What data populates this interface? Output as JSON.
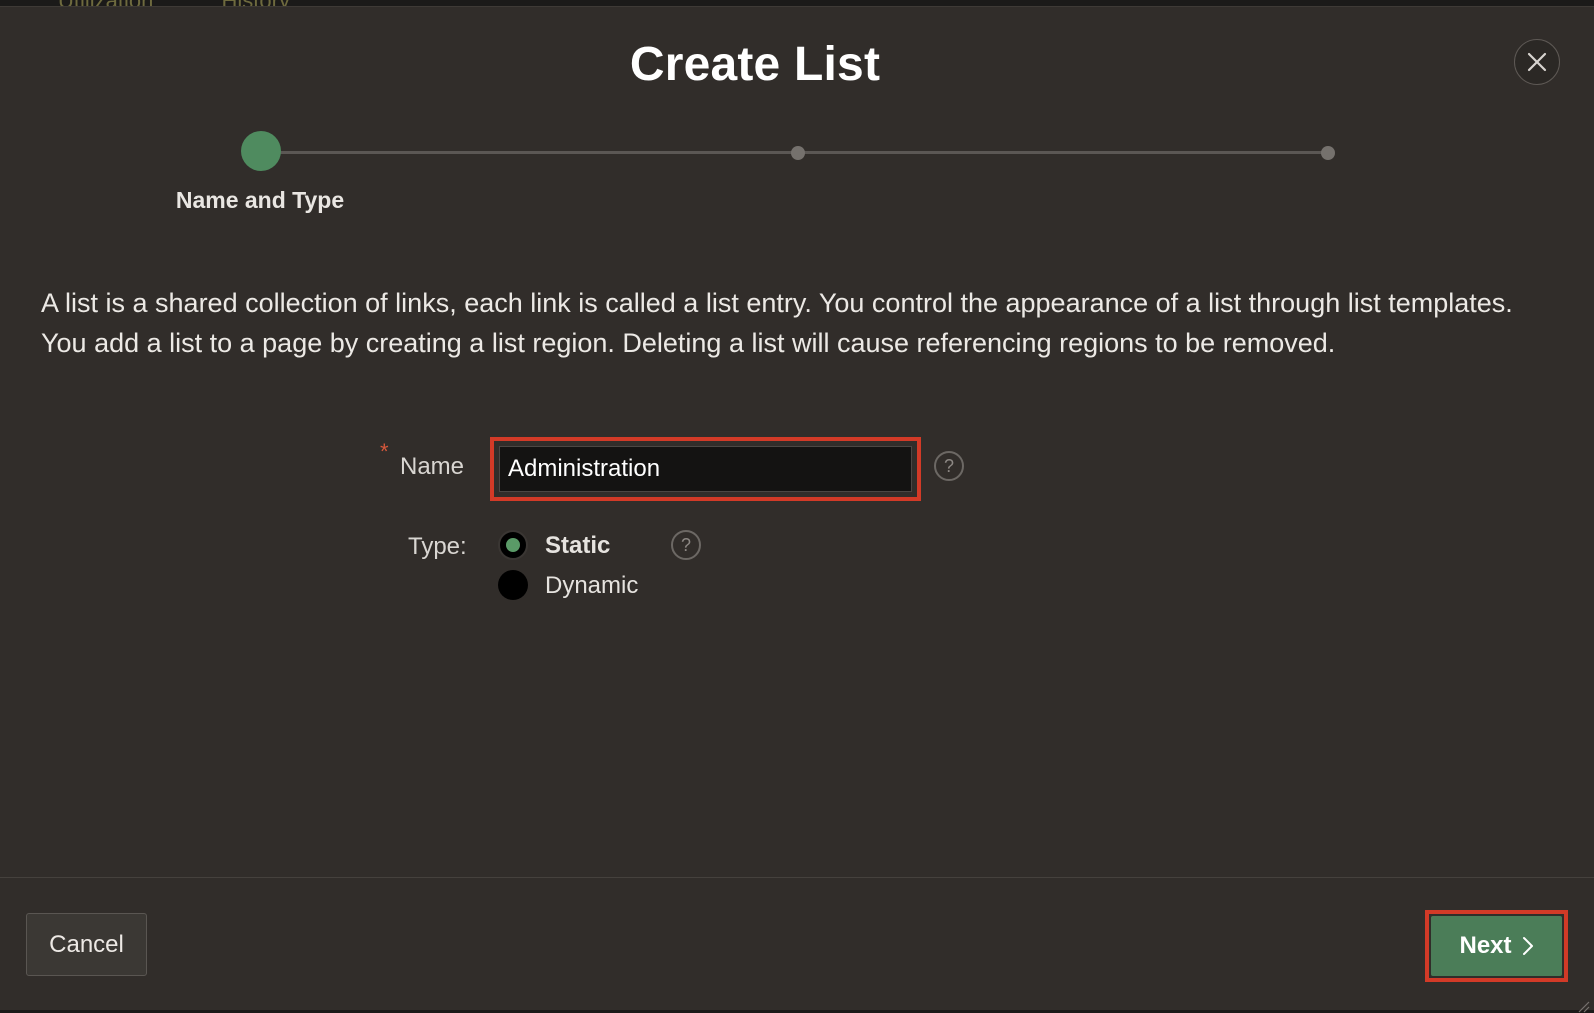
{
  "backdrop": {
    "tab_1": "Utilization",
    "tab_2": "History"
  },
  "dialog": {
    "title": "Create List",
    "close_icon": "close-icon"
  },
  "wizard": {
    "current_step_label": "Name and Type",
    "total_steps": 3,
    "current_step": 1
  },
  "description": "A list is a shared collection of links, each link is called a list entry. You control the appearance of a list through list templates. You add a list to a page by creating a list region. Deleting a list will cause referencing regions to be removed.",
  "form": {
    "required_marker": "*",
    "name_label": "Name",
    "name_value": "Administration",
    "help_symbol": "?",
    "type_label": "Type:",
    "type_options": [
      "Static",
      "Dynamic"
    ],
    "type_selected": "Static"
  },
  "footer": {
    "cancel_label": "Cancel",
    "next_label": "Next"
  },
  "colors": {
    "accent_green": "#4f8b5f",
    "highlight_red": "#d23a27",
    "dialog_bg": "#312d2a"
  }
}
